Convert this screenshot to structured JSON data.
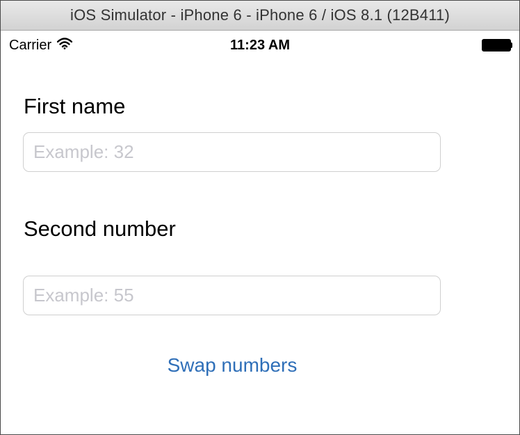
{
  "window": {
    "title": "iOS Simulator - iPhone 6 - iPhone 6 / iOS 8.1 (12B411)"
  },
  "status_bar": {
    "carrier": "Carrier",
    "time": "11:23 AM",
    "icons": [
      "wifi-icon",
      "battery-icon"
    ]
  },
  "form": {
    "first_label": "First name",
    "first_placeholder": "Example: 32",
    "first_value": "",
    "second_label": "Second number",
    "second_placeholder": "Example: 55",
    "second_value": "",
    "swap_button_label": "Swap numbers"
  },
  "colors": {
    "accent": "#2f6fb8",
    "placeholder": "#c7c7cd",
    "field_border": "#cfcfcf"
  }
}
